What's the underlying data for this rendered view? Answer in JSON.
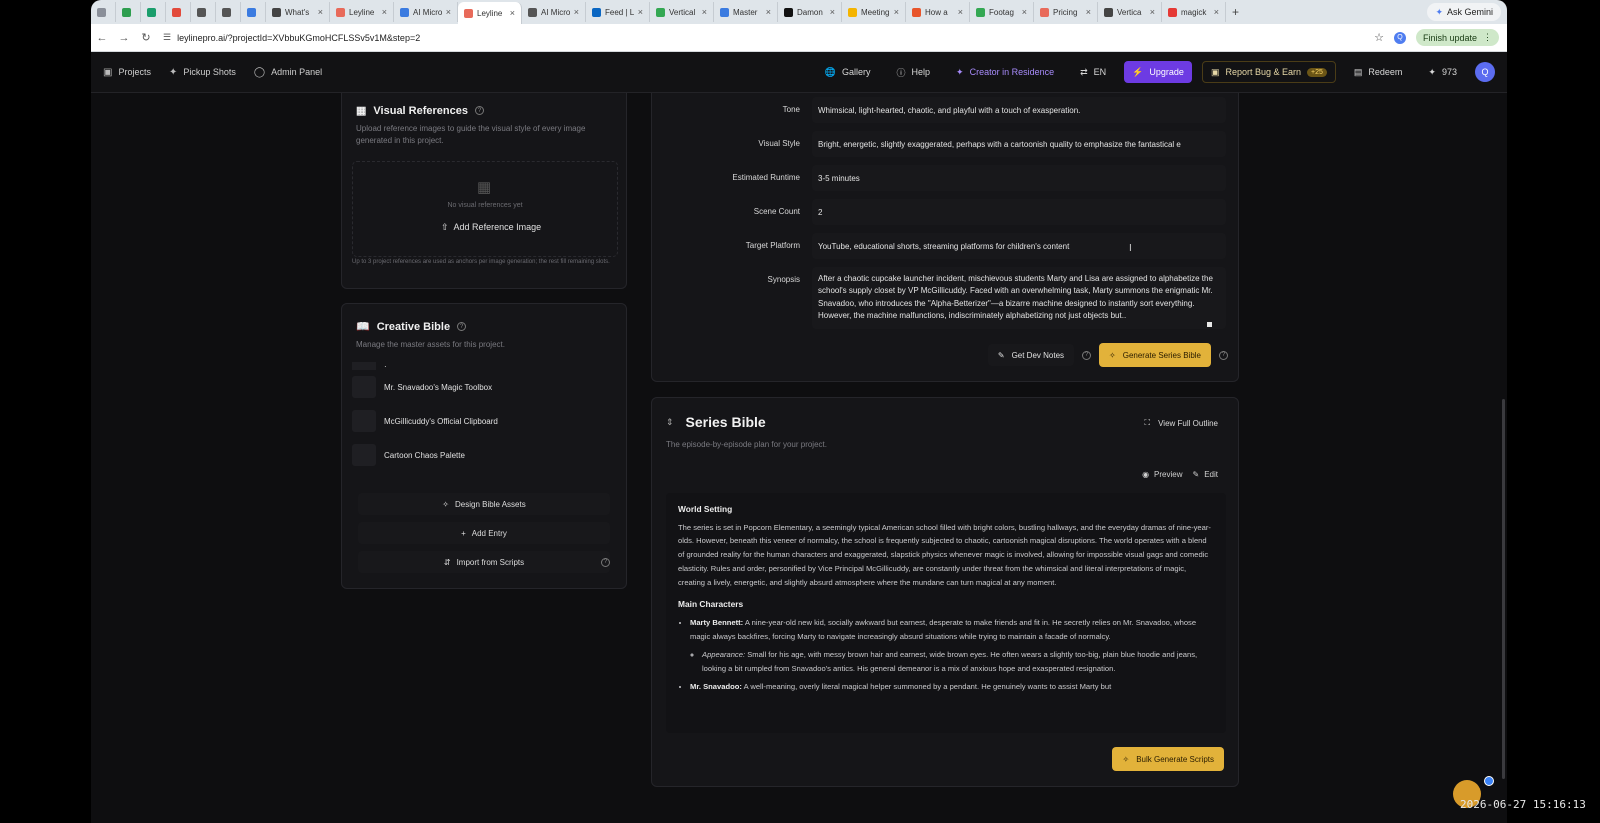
{
  "browser": {
    "tabs": [
      {
        "label": "",
        "pinned": true,
        "color": "#8a8f99"
      },
      {
        "label": "",
        "pinned": true,
        "color": "#2e9e4f"
      },
      {
        "label": "",
        "pinned": true,
        "color": "#1a9e6c"
      },
      {
        "label": "",
        "pinned": true,
        "color": "#e24a3b"
      },
      {
        "label": "",
        "pinned": true,
        "color": "#555555"
      },
      {
        "label": "",
        "pinned": true,
        "color": "#555555"
      },
      {
        "label": "",
        "pinned": true,
        "color": "#3b7be0"
      },
      {
        "label": "What's",
        "color": "#444444"
      },
      {
        "label": "Leyline",
        "color": "#e86a5a"
      },
      {
        "label": "AI Micro",
        "color": "#3b7be0"
      },
      {
        "label": "Leyline",
        "color": "#e86a5a",
        "active": true
      },
      {
        "label": "AI Micro",
        "color": "#555555"
      },
      {
        "label": "Feed | L",
        "color": "#0a66c2"
      },
      {
        "label": "Vertical",
        "color": "#34a853"
      },
      {
        "label": "Master",
        "color": "#3b7be0"
      },
      {
        "label": "Damon",
        "color": "#111111"
      },
      {
        "label": "Meeting",
        "color": "#f4b400"
      },
      {
        "label": "How a",
        "color": "#e8552b"
      },
      {
        "label": "Footag",
        "color": "#34a853"
      },
      {
        "label": "Pricing",
        "color": "#e86a5a"
      },
      {
        "label": "Vertica",
        "color": "#444444"
      },
      {
        "label": "magick",
        "color": "#e53935"
      }
    ],
    "new_tab": "+",
    "ask_gemini": "Ask Gemini",
    "url": "leylinepro.ai/?projectId=XVbbuKGmoHCFLSSv5v1M&step=2",
    "finish_update": "Finish update",
    "profile_initial": "Q"
  },
  "nav": {
    "left": [
      {
        "label": "Projects",
        "icon": "projects-icon"
      },
      {
        "label": "Pickup Shots",
        "icon": "sparkle-icon"
      },
      {
        "label": "Admin Panel",
        "icon": "shield-icon"
      }
    ],
    "gallery": "Gallery",
    "help": "Help",
    "creator": "Creator in Residence",
    "lang": "EN",
    "upgrade": "Upgrade",
    "report": "Report Bug & Earn",
    "report_badge": "+25",
    "redeem": "Redeem",
    "credits": "973",
    "avatar": "Q"
  },
  "visual_references": {
    "title": "Visual References",
    "subtitle": "Upload reference images to guide the visual style of every image generated in this project.",
    "empty": "No visual references yet",
    "add_button": "Add Reference Image",
    "note": "Up to 3 project references are used as anchors per image generation; the rest fill remaining slots."
  },
  "creative_bible": {
    "title": "Creative Bible",
    "subtitle": "Manage the master assets for this project.",
    "partial_item": "·",
    "items": [
      "Mr. Snavadoo's Magic Toolbox",
      "McGillicuddy's Official Clipboard",
      "Cartoon Chaos Palette"
    ],
    "design_button": "Design Bible Assets",
    "add_button": "Add Entry",
    "import_button": "Import from Scripts"
  },
  "details": {
    "rows": [
      {
        "label": "Tone",
        "value": "Whimsical, light-hearted, chaotic, and playful with a touch of exasperation."
      },
      {
        "label": "Visual Style",
        "value": "Bright, energetic, slightly exaggerated, perhaps with a cartoonish quality to emphasize the fantastical e"
      },
      {
        "label": "Estimated Runtime",
        "value": "3-5 minutes"
      },
      {
        "label": "Scene Count",
        "value": "2"
      },
      {
        "label": "Target Platform",
        "value": "YouTube, educational shorts, streaming platforms for children's content"
      }
    ],
    "synopsis_label": "Synopsis",
    "synopsis": "After a chaotic cupcake launcher incident, mischievous students Marty and Lisa are assigned to alphabetize the school's supply closet by VP McGillicuddy. Faced with an overwhelming task, Marty summons the enigmatic Mr. Snavadoo, who introduces the \"Alpha-Betterizer\"—a bizarre machine designed to instantly sort everything. However, the machine malfunctions, indiscriminately alphabetizing not just objects but..",
    "dev_notes": "Get Dev Notes",
    "generate": "Generate Series Bible"
  },
  "series_bible": {
    "title": "Series Bible",
    "subtitle": "The episode-by-episode plan for your project.",
    "view_outline": "View Full Outline",
    "preview": "Preview",
    "edit": "Edit",
    "world_heading": "World Setting",
    "world_text": "The series is set in Popcorn Elementary, a seemingly typical American school filled with bright colors, bustling hallways, and the everyday dramas of nine-year-olds. However, beneath this veneer of normalcy, the school is frequently subjected to chaotic, cartoonish magical disruptions. The world operates with a blend of grounded reality for the human characters and exaggerated, slapstick physics whenever magic is involved, allowing for impossible visual gags and comedic elasticity. Rules and order, personified by Vice Principal McGillicuddy, are constantly under threat from the whimsical and literal interpretations of magic, creating a lively, energetic, and slightly absurd atmosphere where the mundane can turn magical at any moment.",
    "characters_heading": "Main Characters",
    "c1_name": "Marty Bennett:",
    "c1_text": " A nine-year-old new kid, socially awkward but earnest, desperate to make friends and fit in. He secretly relies on Mr. Snavadoo, whose magic always backfires, forcing Marty to navigate increasingly absurd situations while trying to maintain a facade of normalcy.",
    "c1_app_label": "Appearance:",
    "c1_app_text": " Small for his age, with messy brown hair and earnest, wide brown eyes. He often wears a slightly too-big, plain blue hoodie and jeans, looking a bit rumpled from Snavadoo's antics. His general demeanor is a mix of anxious hope and exasperated resignation.",
    "c2_name": "Mr. Snavadoo:",
    "c2_text": " A well-meaning, overly literal magical helper summoned by a pendant. He genuinely wants to assist Marty but",
    "bulk_button": "Bulk Generate Scripts"
  },
  "overlay": {
    "timestamp": "2026-06-27  15:16:13"
  }
}
